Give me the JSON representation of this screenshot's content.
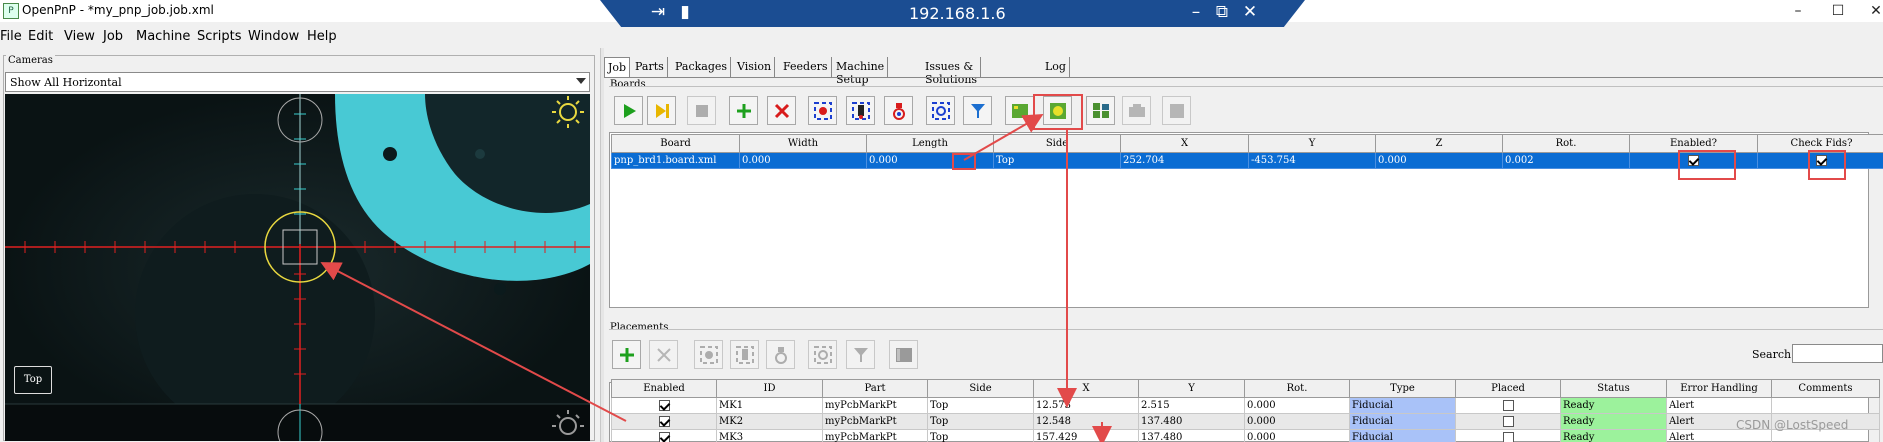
{
  "window": {
    "title": "OpenPnP - *my_pnp_job.job.xml",
    "icon": "openpnp-app-icon",
    "controls": [
      "minimize",
      "maximize",
      "close"
    ]
  },
  "remote_bar": {
    "ip": "192.168.1.6"
  },
  "menu": [
    "File",
    "Edit",
    "View",
    "Job",
    "Machine",
    "Scripts",
    "Window",
    "Help"
  ],
  "cameras": {
    "group_title": "Cameras",
    "view_mode": "Show All Horizontal",
    "badge": "Top"
  },
  "tabs": [
    "Job",
    "Parts",
    "Packages",
    "Vision",
    "Feeders",
    "Machine Setup",
    "Issues & Solutions",
    "Log"
  ],
  "active_tab": "Job",
  "boards": {
    "group_title": "Boards",
    "toolbar": [
      "start-job-icon",
      "step-job-icon",
      "stop-job-icon",
      "add-board-icon",
      "remove-board-icon",
      "capture-camera-location-icon",
      "capture-tool-location-icon",
      "move-nozzle-icon",
      "position-camera-icon",
      "move-tool-icon",
      "set-board-location-icon",
      "check-fiducials-icon",
      "panelize-icon",
      "bottom-vision-icon",
      "board-settings-icon"
    ],
    "columns": [
      "Board",
      "Width",
      "Length",
      "Side",
      "X",
      "Y",
      "Z",
      "Rot.",
      "Enabled?",
      "Check Fids?"
    ],
    "rows": [
      {
        "board": "pnp_brd1.board.xml",
        "width": "0.000",
        "length": "0.000",
        "side": "Top",
        "x": "252.704",
        "y": "-453.754",
        "z": "0.000",
        "rot": "0.002",
        "enabled": true,
        "check_fids": true
      }
    ]
  },
  "placements": {
    "group_title": "Placements",
    "toolbar": [
      "add-placement-icon",
      "remove-placement-icon",
      "capture-camera-icon",
      "capture-tool-icon",
      "move-nozzle-icon",
      "position-camera-icon",
      "move-tool-icon",
      "placement-settings-icon"
    ],
    "search_label": "Search",
    "search_value": "",
    "columns": [
      "Enabled",
      "ID",
      "Part",
      "Side",
      "X",
      "Y",
      "Rot.",
      "Type",
      "Placed",
      "Status",
      "Error Handling",
      "Comments"
    ],
    "rows": [
      {
        "enabled": true,
        "id": "MK1",
        "part": "myPcbMarkPt",
        "side": "Top",
        "x": "12.573",
        "y": "2.515",
        "rot": "0.000",
        "type": "Fiducial",
        "placed": false,
        "status": "Ready",
        "error": "Alert",
        "comments": ""
      },
      {
        "enabled": true,
        "id": "MK2",
        "part": "myPcbMarkPt",
        "side": "Top",
        "x": "12.548",
        "y": "137.480",
        "rot": "0.000",
        "type": "Fiducial",
        "placed": false,
        "status": "Ready",
        "error": "Alert",
        "comments": ""
      },
      {
        "enabled": true,
        "id": "MK3",
        "part": "myPcbMarkPt",
        "side": "Top",
        "x": "157.429",
        "y": "137.480",
        "rot": "0.000",
        "type": "Fiducial",
        "placed": false,
        "status": "Ready",
        "error": "Alert",
        "comments": ""
      }
    ]
  },
  "watermark": "CSDN @LostSpeed",
  "colors": {
    "selection": "#0a6cd3",
    "fiducial_type": "#a9c2f8",
    "ready_status": "#9cf29c",
    "annotation_red": "#e24a4a",
    "remote_bar": "#1b4d92"
  }
}
